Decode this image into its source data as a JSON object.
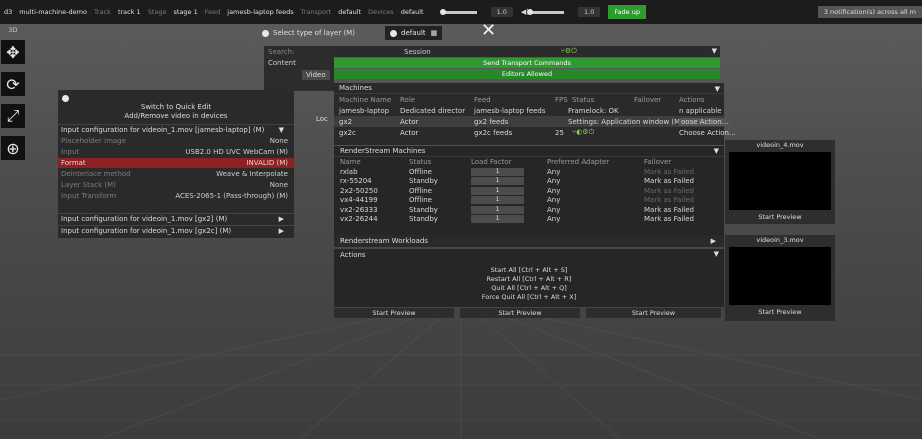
{
  "topbar": {
    "app_icon": "d3",
    "project": "multi-machine-demo",
    "track_label": "Track",
    "track_value": "track 1",
    "stage_label": "Stage",
    "stage_value": "stage 1",
    "feed_label": "Feed",
    "feed_value": "jamesb-laptop feeds",
    "transport_label": "Transport",
    "transport_value": "default",
    "devices_label": "Devices",
    "devices_value": "default",
    "volume_value": "1.0",
    "speaker_value": "1.0",
    "fade_label": "Fade up",
    "notifications": "3 notification(s) across all m"
  },
  "tools": {
    "label": "3D",
    "items": [
      "move-icon",
      "rotate-icon",
      "scale-icon",
      "globe-icon"
    ]
  },
  "layer_select": {
    "title": "Select type of layer (M)",
    "default_label": "default",
    "search_placeholder": "Search:",
    "content_label": "Content",
    "video_label": "Video",
    "session_label": "Session"
  },
  "banners": {
    "send_transport": "Send Transport Commands",
    "editors_allowed": "Editors Allowed"
  },
  "machines": {
    "title": "Machines",
    "columns": [
      "Machine Name",
      "Role",
      "Feed",
      "FPS",
      "Status",
      "Failover",
      "Actions"
    ],
    "rows": [
      {
        "name": "jamesb-laptop",
        "role": "Dedicated director",
        "feed": "jamesb-laptop feeds",
        "fps": "",
        "status": "Framelock: OK",
        "failover": "",
        "actions": "n applicable"
      },
      {
        "name": "gx2",
        "role": "Actor",
        "feed": "gx2 feeds",
        "fps": "",
        "status": "Settings: Application window (M)",
        "failover": "",
        "actions": "oose Action..."
      },
      {
        "name": "gx2c",
        "role": "Actor",
        "feed": "gx2c feeds",
        "fps": "25",
        "status": "",
        "failover": "",
        "actions": "Choose Action..."
      }
    ],
    "loc_label": "Loc"
  },
  "input_panel": {
    "quick_edit": "Switch to Quick Edit",
    "add_remove": "Add/Remove video in devices",
    "section1": "Input configuration for videoin_1.mov [jamesb-laptop] (M)",
    "rows": [
      {
        "key": "Placeholder image",
        "value": "None"
      },
      {
        "key": "Input",
        "value": "USB2.0 HD UVC WebCam (M)"
      },
      {
        "key": "Format",
        "value": "INVALID (M)"
      },
      {
        "key": "Deinterlace method",
        "value": "Weave & Interpolate"
      },
      {
        "key": "Layer Stack (M)",
        "value": "None"
      },
      {
        "key": "Input Transform",
        "value": "ACES-2065-1 (Pass-through) (M)"
      }
    ],
    "section2": "Input configuration for videoin_1.mov [gx2] (M)",
    "section3": "Input configuration for videoin_1.mov [gx2c] (M)"
  },
  "renderstream": {
    "title": "RenderStream Machines",
    "columns": [
      "Name",
      "Status",
      "Load Factor",
      "Preferred Adapter",
      "Failover"
    ],
    "rows": [
      {
        "name": "rxlab",
        "status": "Offline",
        "load": "1",
        "adapter": "Any",
        "failover": "Mark as Failed",
        "dim": true
      },
      {
        "name": "rx-55204",
        "status": "Standby",
        "load": "1",
        "adapter": "Any",
        "failover": "Mark as Failed",
        "dim": false
      },
      {
        "name": "2x2-50250",
        "status": "Offline",
        "load": "1",
        "adapter": "Any",
        "failover": "Mark as Failed",
        "dim": true
      },
      {
        "name": "vx4-44199",
        "status": "Offline",
        "load": "1",
        "adapter": "Any",
        "failover": "Mark as Failed",
        "dim": true
      },
      {
        "name": "vx2-26333",
        "status": "Standby",
        "load": "1",
        "adapter": "Any",
        "failover": "Mark as Failed",
        "dim": false
      },
      {
        "name": "vx2-26244",
        "status": "Standby",
        "load": "1",
        "adapter": "Any",
        "failover": "Mark as Failed",
        "dim": false
      }
    ],
    "workloads_title": "Renderstream Workloads"
  },
  "actions": {
    "title": "Actions",
    "start_all": "Start All [Ctrl + Alt + S]",
    "restart_all": "Restart All [Ctrl + Alt + R]",
    "quit_all": "Quit All [Ctrl + Alt + Q]",
    "force_quit_all": "Force Quit All [Ctrl + Alt + X]"
  },
  "previews": {
    "start_preview": "Start Preview",
    "video4": "videoin_4.mov",
    "video3": "videoin_3.mov"
  },
  "colors": {
    "green_banner": "#2f9a2f",
    "error_row": "#8e2222",
    "fade_button": "#2d9c2d"
  }
}
